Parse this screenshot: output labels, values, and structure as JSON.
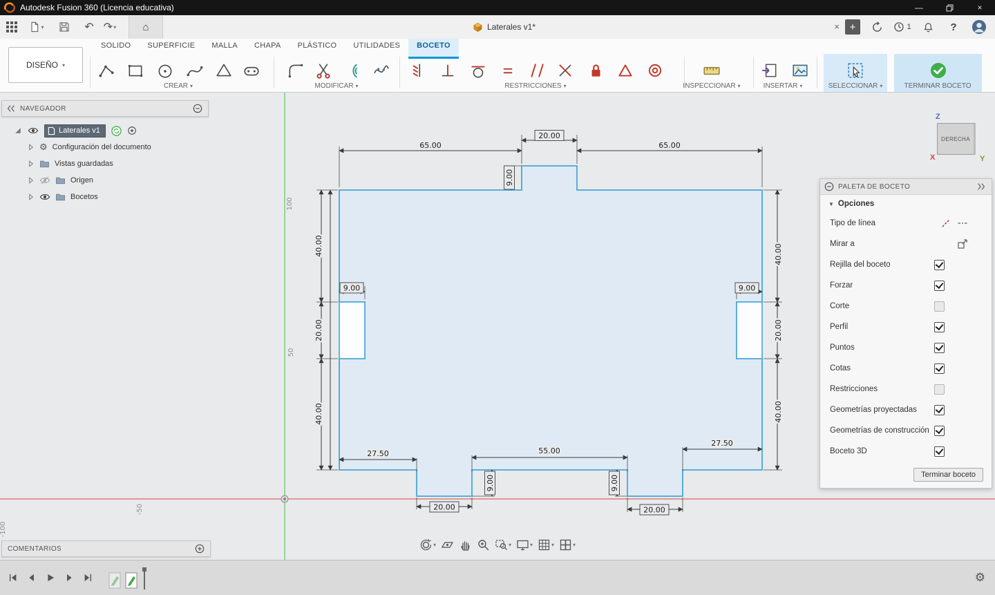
{
  "window": {
    "title": "Autodesk Fusion 360 (Licencia educativa)"
  },
  "toolbar": {
    "document_tab": "Laterales v1*",
    "notifications": "1"
  },
  "ribbon": {
    "design_menu_label": "DISEÑO",
    "tabs": [
      {
        "label": "SOLIDO"
      },
      {
        "label": "SUPERFICIE"
      },
      {
        "label": "MALLA"
      },
      {
        "label": "CHAPA"
      },
      {
        "label": "PLÁSTICO"
      },
      {
        "label": "UTILIDADES"
      },
      {
        "label": "BOCETO",
        "active": true
      }
    ],
    "groups": {
      "crear": "CREAR",
      "modificar": "MODIFICAR",
      "restricciones": "RESTRICCIONES",
      "inspeccionar": "INSPECCIONAR",
      "insertar": "INSERTAR",
      "seleccionar": "SELECCIONAR",
      "terminar": "TERMINAR BOCETO"
    }
  },
  "navigator": {
    "header": "NAVEGADOR",
    "root_item": "Laterales v1",
    "items": [
      {
        "label": "Configuración del documento"
      },
      {
        "label": "Vistas guardadas"
      },
      {
        "label": "Origen"
      },
      {
        "label": "Bocetos"
      }
    ]
  },
  "comments": {
    "header": "COMENTARIOS"
  },
  "sketch_palette": {
    "header": "PALETA DE BOCETO",
    "section": "Opciones",
    "rows": [
      {
        "label": "Tipo de línea"
      },
      {
        "label": "Mirar a"
      },
      {
        "label": "Rejilla del boceto",
        "checked": true
      },
      {
        "label": "Forzar",
        "checked": true
      },
      {
        "label": "Corte",
        "checked": false
      },
      {
        "label": "Perfil",
        "checked": true
      },
      {
        "label": "Puntos",
        "checked": true
      },
      {
        "label": "Cotas",
        "checked": true
      },
      {
        "label": "Restricciones",
        "checked": false
      },
      {
        "label": "Geometrías proyectadas",
        "checked": true
      },
      {
        "label": "Geometrías de construcción",
        "checked": true
      },
      {
        "label": "Boceto 3D",
        "checked": true
      }
    ],
    "finish_button": "Terminar boceto"
  },
  "viewcube": {
    "face": "DERECHA",
    "axis_x": "X",
    "axis_y": "Y",
    "axis_z": "Z"
  },
  "canvas": {
    "axis_labels": {
      "y_100": "100",
      "y_50": "50",
      "x_neg50": "-50",
      "x_neg100": "-100"
    },
    "dimensions": {
      "top_left": "65.00",
      "top_tab_width": "20.00",
      "top_right": "65.00",
      "top_tab_height": "9.00",
      "left_upper": "40.00",
      "left_notch_height": "20.00",
      "left_lower": "40.00",
      "left_notch_depth": "9.00",
      "right_notch_depth": "9.00",
      "right_upper": "40.00",
      "right_notch_height": "20.00",
      "right_lower": "40.00",
      "bottom_left": "27.50",
      "bottom_middle": "55.00",
      "bottom_right": "27.50",
      "bottom_tab_left_height": "9.00",
      "bottom_tab_right_height": "9.00",
      "bottom_tab_left_width": "20.00",
      "bottom_tab_right_width": "20.00"
    }
  },
  "colors": {
    "accent_blue": "#0696d7",
    "sketch_line": "#45a7d8",
    "profile_fill": "#dfeaf4",
    "axis_x_red": "#e07b7b",
    "axis_y_green": "#79c879",
    "finish_green": "#3fae49"
  }
}
